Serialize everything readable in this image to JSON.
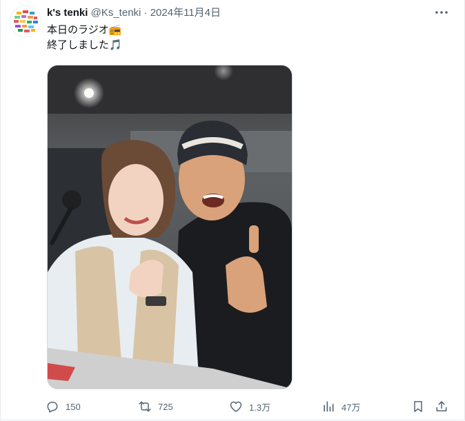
{
  "tweet": {
    "author_name": "k's tenki",
    "author_handle": "@Ks_tenki",
    "separator": "·",
    "date": "2024年11月4日",
    "text_line1": "本日のラジオ📻",
    "text_line2": "終了しました🎵"
  },
  "actions": {
    "replies": "150",
    "reposts": "725",
    "likes": "1.3万",
    "views": "47万"
  },
  "icons": {
    "more": "more-horizontal-icon",
    "reply": "reply-icon",
    "repost": "repost-icon",
    "like": "heart-icon",
    "views": "views-icon",
    "bookmark": "bookmark-icon",
    "share": "share-icon"
  },
  "colors": {
    "text": "#0f1419",
    "secondary": "#536471",
    "border": "#cfd9de"
  }
}
